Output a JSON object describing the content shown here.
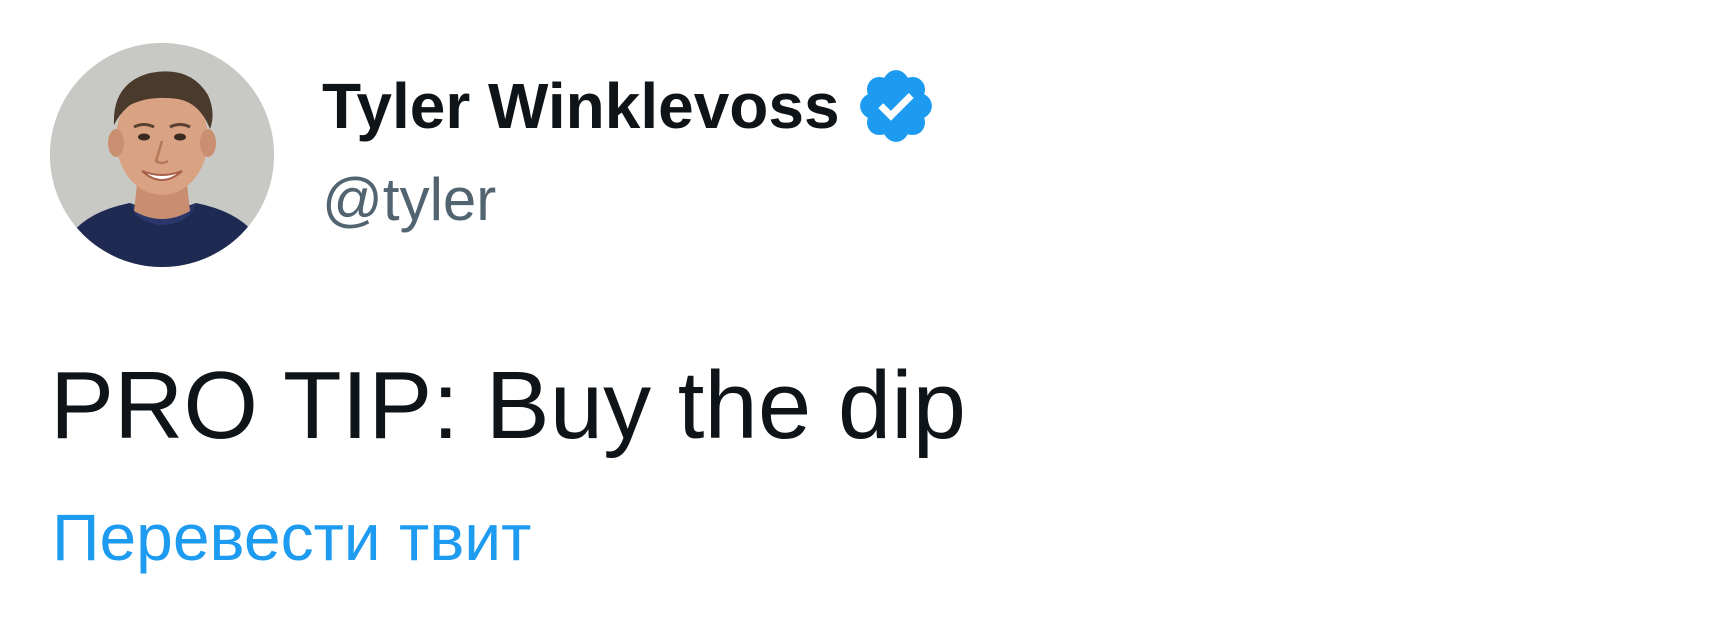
{
  "tweet": {
    "author": {
      "display_name": "Tyler Winklevoss",
      "handle": "@tyler",
      "verified": true,
      "avatar_icon": "profile-photo"
    },
    "text": "PRO TIP: Buy the dip",
    "translate_label": "Перевести твит"
  },
  "colors": {
    "text_primary": "#0f1419",
    "text_secondary": "#536471",
    "accent": "#1d9bf0",
    "background": "#ffffff"
  }
}
